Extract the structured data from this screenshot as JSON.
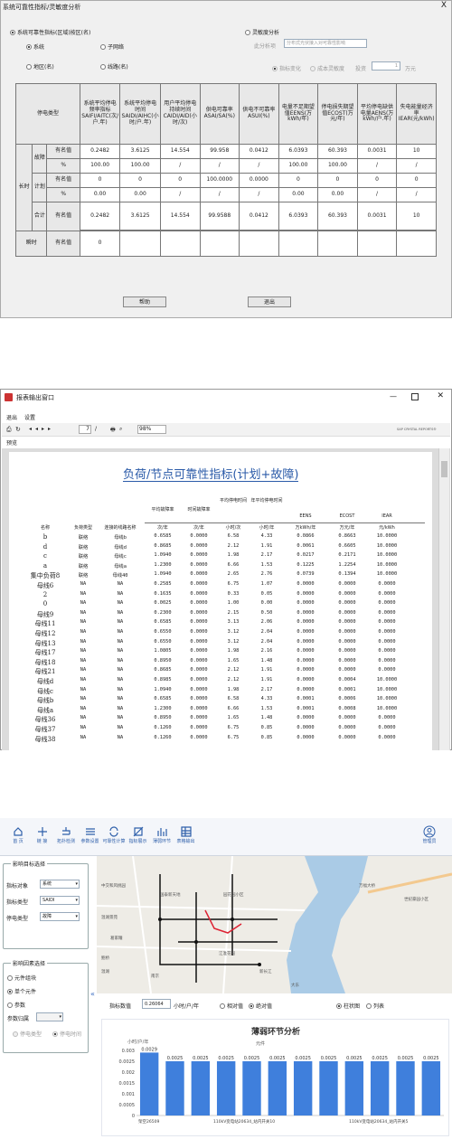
{
  "win1": {
    "title": "系统可靠性指标/灵敏度分析",
    "close": "X",
    "opt_system_metrics": "系统可靠性指标(区域)按区(名)",
    "opt_system": "系统",
    "opt_subsystem": "子网络",
    "opt_region": "地区(名)",
    "opt_line": "线路(名)",
    "opt_sensitivity": "灵敏度分析",
    "label_analysis": "此分析项",
    "analysis_value": "分布式光伏接入对可靠性影响",
    "opt_index_change": "指标变化",
    "opt_cost_sensitivity": "成本灵敏度",
    "label_investment": "投资",
    "investment_value": "1",
    "unit_wan": "万元",
    "table": {
      "headers": [
        "停电类型",
        "系统平均停电频率指标SAIFI/AITC(次/户.年)",
        "系统平均停电时间SAIDI/AIHC(小时/户.年)",
        "用户平均停电持续时间CAIDI/AID(小时/次)",
        "供电可靠率ASAI/SA(%)",
        "供电不可靠率ASUI(%)",
        "电量不足期望值EENS(万kWh/年)",
        "停电损失期望值ECOST(万元/年)",
        "平均停电缺供电量AENS(万kWh/户.年)",
        "失电能量经济率IEAR(元/kWh)"
      ],
      "lbl_long": "长时",
      "lbl_fault": "故障",
      "lbl_plan": "计划",
      "lbl_total": "合计",
      "lbl_short": "瞬时",
      "lbl_named": "有名值",
      "lbl_pct": "%",
      "fault_named": [
        "0.2482",
        "3.6125",
        "14.554",
        "99.958",
        "0.0412",
        "6.0393",
        "60.393",
        "0.0031",
        "10"
      ],
      "fault_pct": [
        "100.00",
        "100.00",
        "/",
        "/",
        "/",
        "100.00",
        "100.00",
        "/",
        "/"
      ],
      "plan_named": [
        "0",
        "0",
        "0",
        "100.0000",
        "0.0000",
        "0",
        "0",
        "0",
        "0"
      ],
      "plan_pct": [
        "0.00",
        "0.00",
        "/",
        "/",
        "/",
        "0.00",
        "0.00",
        "/",
        "/"
      ],
      "total_named": [
        "0.2482",
        "3.6125",
        "14.554",
        "99.9588",
        "0.0412",
        "6.0393",
        "60.393",
        "0.0031",
        "10"
      ],
      "short_named": "0"
    },
    "btn_help": "帮助",
    "btn_exit": "退出"
  },
  "win2": {
    "title": "报表输出窗口",
    "menu_exit": "退出",
    "menu_settings": "设置",
    "page_current": "7",
    "page_sep": "/",
    "zoom": "98%",
    "crystal": "SAP CRYSTAL REPORTS®",
    "tab_preview": "预览",
    "report_title": "负荷/节点可靠性指标(计划+故障)",
    "col_top": [
      "平均故障率",
      "时间故障率",
      "平均停电时间",
      "年平均停电时间",
      "EENS",
      "ECOST",
      "IEAR"
    ],
    "col_bottom": [
      "名称",
      "负荷类型",
      "连接的线路名称",
      "次/年",
      "次/年",
      "小时/次",
      "小时/年",
      "万kWh/年",
      "万元/年",
      "元/kWh"
    ],
    "rows": [
      [
        "b",
        "联络",
        "母线b",
        "0.6585",
        "0.0000",
        "6.58",
        "4.33",
        "0.0866",
        "0.8663",
        "10.0000"
      ],
      [
        "d",
        "联络",
        "母线d",
        "0.8685",
        "0.0000",
        "2.12",
        "1.91",
        "0.0061",
        "0.6605",
        "10.0000"
      ],
      [
        "c",
        "联络",
        "母线c",
        "1.0940",
        "0.0000",
        "1.98",
        "2.17",
        "0.0217",
        "0.2171",
        "10.0000"
      ],
      [
        "a",
        "联络",
        "母线a",
        "1.2300",
        "0.0000",
        "6.66",
        "1.53",
        "0.1225",
        "1.2254",
        "10.0000"
      ],
      [
        "集中负荷8",
        "联络",
        "母线40",
        "1.0940",
        "0.0000",
        "2.65",
        "2.76",
        "0.0739",
        "0.1394",
        "10.0000"
      ],
      [
        "母线6",
        "NA",
        "NA",
        "0.2585",
        "0.0000",
        "6.75",
        "1.07",
        "0.0000",
        "0.0000",
        "0.0000"
      ],
      [
        "2",
        "NA",
        "NA",
        "0.1635",
        "0.0000",
        "0.33",
        "0.05",
        "0.0000",
        "0.0000",
        "0.0000"
      ],
      [
        "0",
        "NA",
        "NA",
        "0.0025",
        "0.0000",
        "1.00",
        "0.00",
        "0.0000",
        "0.0000",
        "0.0000"
      ],
      [
        "母线9",
        "NA",
        "NA",
        "0.2300",
        "0.0000",
        "2.15",
        "0.50",
        "0.0000",
        "0.0000",
        "0.0000"
      ],
      [
        "母线11",
        "NA",
        "NA",
        "0.6585",
        "0.0000",
        "3.13",
        "2.06",
        "0.0000",
        "0.0000",
        "0.0000"
      ],
      [
        "母线12",
        "NA",
        "NA",
        "0.6550",
        "0.0000",
        "3.12",
        "2.04",
        "0.0000",
        "0.0000",
        "0.0000"
      ],
      [
        "母线13",
        "NA",
        "NA",
        "0.6550",
        "0.0000",
        "3.12",
        "2.04",
        "0.0000",
        "0.0000",
        "0.0000"
      ],
      [
        "母线17",
        "NA",
        "NA",
        "1.0805",
        "0.0000",
        "1.98",
        "2.16",
        "0.0000",
        "0.0000",
        "0.0000"
      ],
      [
        "母线18",
        "NA",
        "NA",
        "0.8950",
        "0.0000",
        "1.65",
        "1.48",
        "0.0000",
        "0.0000",
        "0.0000"
      ],
      [
        "母线21",
        "NA",
        "NA",
        "0.8685",
        "0.0000",
        "2.12",
        "1.91",
        "0.0000",
        "0.0000",
        "0.0000"
      ],
      [
        "母线d",
        "NA",
        "NA",
        "0.8985",
        "0.0000",
        "2.12",
        "1.91",
        "0.0000",
        "0.0004",
        "10.0000"
      ],
      [
        "母线c",
        "NA",
        "NA",
        "1.0940",
        "0.0000",
        "1.98",
        "2.17",
        "0.0000",
        "0.0001",
        "10.0000"
      ],
      [
        "母线b",
        "NA",
        "NA",
        "0.6585",
        "0.0000",
        "6.58",
        "4.33",
        "0.0001",
        "0.0006",
        "10.0000"
      ],
      [
        "母线a",
        "NA",
        "NA",
        "1.2300",
        "0.0000",
        "6.66",
        "1.53",
        "0.0001",
        "0.0008",
        "10.0000"
      ],
      [
        "母线36",
        "NA",
        "NA",
        "0.8950",
        "0.0000",
        "1.65",
        "1.48",
        "0.0000",
        "0.0000",
        "0.0000"
      ],
      [
        "母线37",
        "NA",
        "NA",
        "0.1260",
        "0.0000",
        "6.75",
        "0.85",
        "0.0000",
        "0.0000",
        "0.0000"
      ],
      [
        "母线38",
        "NA",
        "NA",
        "0.1260",
        "0.0000",
        "6.75",
        "0.85",
        "0.0000",
        "0.0000",
        "0.0000"
      ]
    ]
  },
  "win3": {
    "nav": [
      "首 页",
      "链 接",
      "拓扑检测",
      "参数设置",
      "可靠性计算",
      "指标展示",
      "薄弱环节",
      "表格输出"
    ],
    "user": "管理员",
    "grp_target": "影响目标选择",
    "lbl_object": "指标对象",
    "val_object": "系统",
    "lbl_type": "指标类型",
    "val_type": "SAIDI",
    "lbl_outage": "停电类型",
    "val_outage": "故障",
    "grp_factor": "影响因素选择",
    "opt_component_group": "元件组块",
    "opt_single": "单个元件",
    "opt_param": "参数",
    "lbl_param_attr": "参数归属",
    "opt_outage_type": "停电类型",
    "opt_outage_time": "停电时间",
    "collapse": "«",
    "lbl_index_value": "指标数值",
    "index_value": "0.26064",
    "index_unit": "小时/户/年",
    "opt_relative": "相对值",
    "opt_absolute": "绝对值",
    "opt_bar": "柱状图",
    "opt_table": "列表",
    "map_labels": [
      "万福大桥",
      "世纪豪园小区",
      "中交和风桃园",
      "温湖景苑",
      "葛家疃",
      "鲍桥",
      "温湖",
      "新长江",
      "江淮花园",
      "国泰新天地",
      "南京",
      "园花园小区",
      "大东"
    ]
  },
  "chart_data": {
    "type": "bar",
    "title": "薄弱环节分析",
    "ylabel": "小时/户/年",
    "subtitle": "元件",
    "ylim": [
      0,
      0.003
    ],
    "yticks": [
      "0.003",
      "0.0025",
      "0.002",
      "0.0015",
      "0.001",
      "0.0005",
      "0"
    ],
    "values": [
      0.0029,
      0.0025,
      0.0025,
      0.0025,
      0.0025,
      0.0025,
      0.0025,
      0.0025,
      0.0025,
      0.0025,
      0.0025,
      0.0025
    ],
    "value_labels": [
      "0.0029",
      "0.0025",
      "0.0025",
      "0.0025",
      "0.0025",
      "0.0025",
      "0.0025",
      "0.0025",
      "0.0025",
      "0.0025",
      "0.0025",
      "0.0025"
    ],
    "x_labels_visible": [
      "架空26509",
      "110kV变电站20634_站内开关10",
      "110kV变电站20634_站内开关5"
    ]
  }
}
